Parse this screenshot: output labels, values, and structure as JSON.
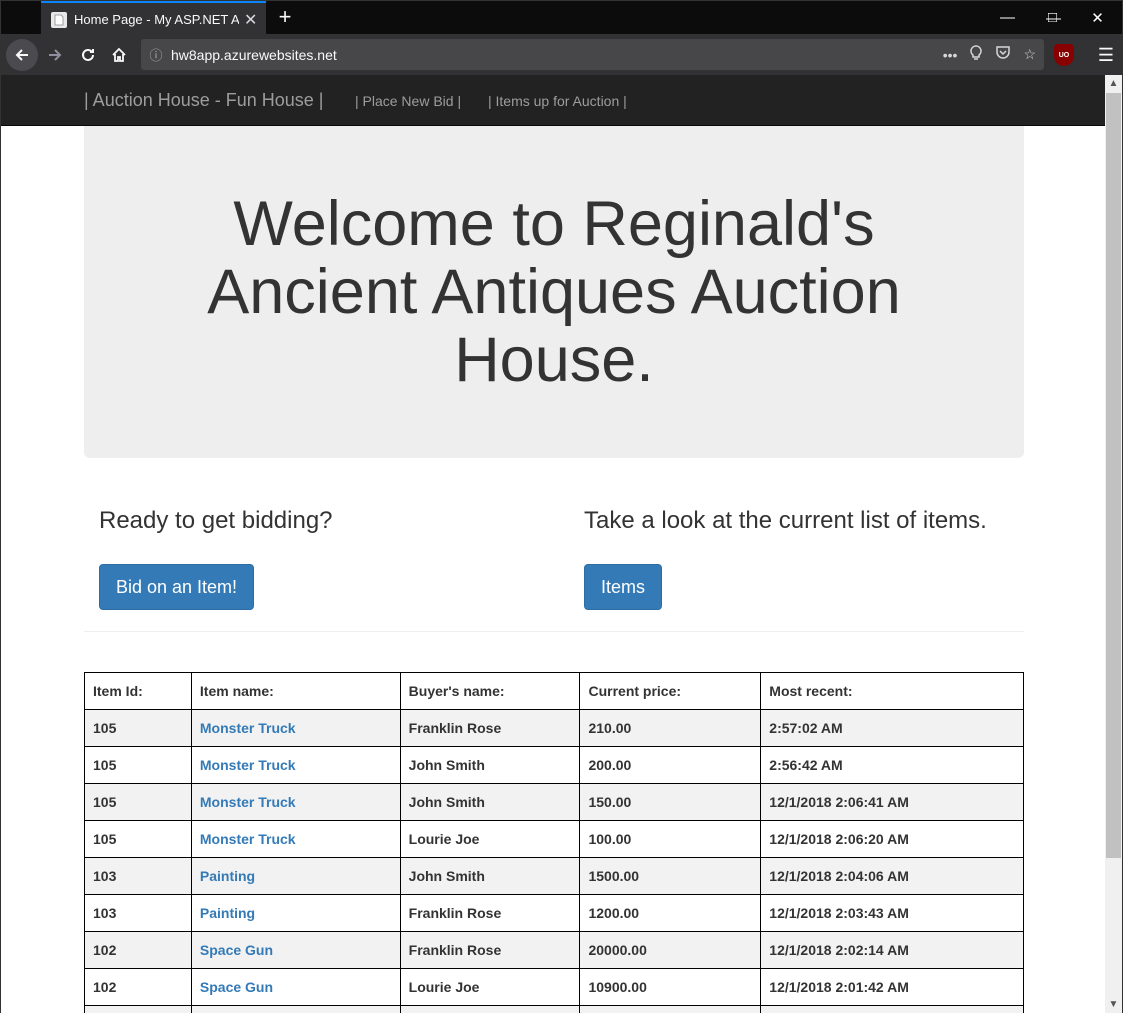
{
  "browser": {
    "tab_title": "Home Page - My ASP.NET App",
    "url": "hw8app.azurewebsites.net",
    "ublock_label": "UO"
  },
  "site": {
    "brand": "| Auction House - Fun House |",
    "nav": [
      {
        "label": "| Place New Bid |"
      },
      {
        "label": "| Items up for Auction |"
      }
    ]
  },
  "hero": {
    "heading": "Welcome to Reginald's Ancient Antiques Auction House."
  },
  "panels": {
    "left": {
      "heading": "Ready to get bidding?",
      "button": "Bid on an Item!"
    },
    "right": {
      "heading": "Take a look at the current list of items.",
      "button": "Items"
    }
  },
  "table": {
    "headers": [
      "Item Id:",
      "Item name:",
      "Buyer's name:",
      "Current price:",
      "Most recent:"
    ],
    "rows": [
      {
        "id": "105",
        "name": "Monster Truck",
        "buyer": "Franklin Rose",
        "price": "210.00",
        "recent": "2:57:02 AM"
      },
      {
        "id": "105",
        "name": "Monster Truck",
        "buyer": "John Smith",
        "price": "200.00",
        "recent": "2:56:42 AM"
      },
      {
        "id": "105",
        "name": "Monster Truck",
        "buyer": "John Smith",
        "price": "150.00",
        "recent": "12/1/2018 2:06:41 AM"
      },
      {
        "id": "105",
        "name": "Monster Truck",
        "buyer": "Lourie Joe",
        "price": "100.00",
        "recent": "12/1/2018 2:06:20 AM"
      },
      {
        "id": "103",
        "name": "Painting",
        "buyer": "John Smith",
        "price": "1500.00",
        "recent": "12/1/2018 2:04:06 AM"
      },
      {
        "id": "103",
        "name": "Painting",
        "buyer": "Franklin Rose",
        "price": "1200.00",
        "recent": "12/1/2018 2:03:43 AM"
      },
      {
        "id": "102",
        "name": "Space Gun",
        "buyer": "Franklin Rose",
        "price": "20000.00",
        "recent": "12/1/2018 2:02:14 AM"
      },
      {
        "id": "102",
        "name": "Space Gun",
        "buyer": "Lourie Joe",
        "price": "10900.00",
        "recent": "12/1/2018 2:01:42 AM"
      }
    ]
  },
  "colors": {
    "accent": "#337ab7",
    "navbar": "#222222",
    "jumbotron": "#eeeeee"
  }
}
